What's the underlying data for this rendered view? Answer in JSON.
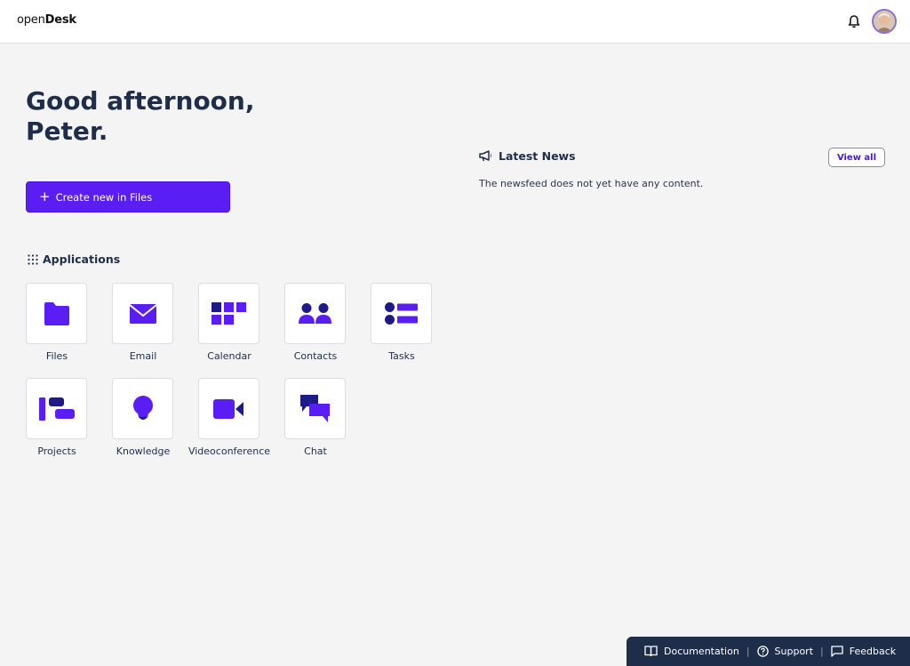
{
  "header": {
    "logo_light": "open",
    "logo_bold": "Desk",
    "bell_icon": "bell-icon",
    "avatar_alt": "user-avatar"
  },
  "greeting": {
    "line1": "Good afternoon,",
    "line2": "Peter."
  },
  "create_button": {
    "plus": "+",
    "label": "Create new in Files"
  },
  "applications": {
    "title": "Applications",
    "items": [
      {
        "label": "Files",
        "icon": "folder-icon"
      },
      {
        "label": "Email",
        "icon": "envelope-icon"
      },
      {
        "label": "Calendar",
        "icon": "calendar-grid-icon"
      },
      {
        "label": "Contacts",
        "icon": "contacts-icon"
      },
      {
        "label": "Tasks",
        "icon": "tasks-list-icon"
      },
      {
        "label": "Projects",
        "icon": "projects-icon"
      },
      {
        "label": "Knowledge",
        "icon": "lightbulb-icon"
      },
      {
        "label": "Videoconference",
        "icon": "video-camera-icon"
      },
      {
        "label": "Chat",
        "icon": "chat-bubbles-icon"
      }
    ]
  },
  "news": {
    "title": "Latest News",
    "view_all": "View all",
    "empty_text": "The newsfeed does not yet have any content."
  },
  "footer": {
    "documentation": "Documentation",
    "support": "Support",
    "feedback": "Feedback",
    "separator": "|"
  },
  "colors": {
    "accent": "#5a1ef5",
    "navy": "#1e2d4a",
    "background": "#f4f4f5"
  }
}
